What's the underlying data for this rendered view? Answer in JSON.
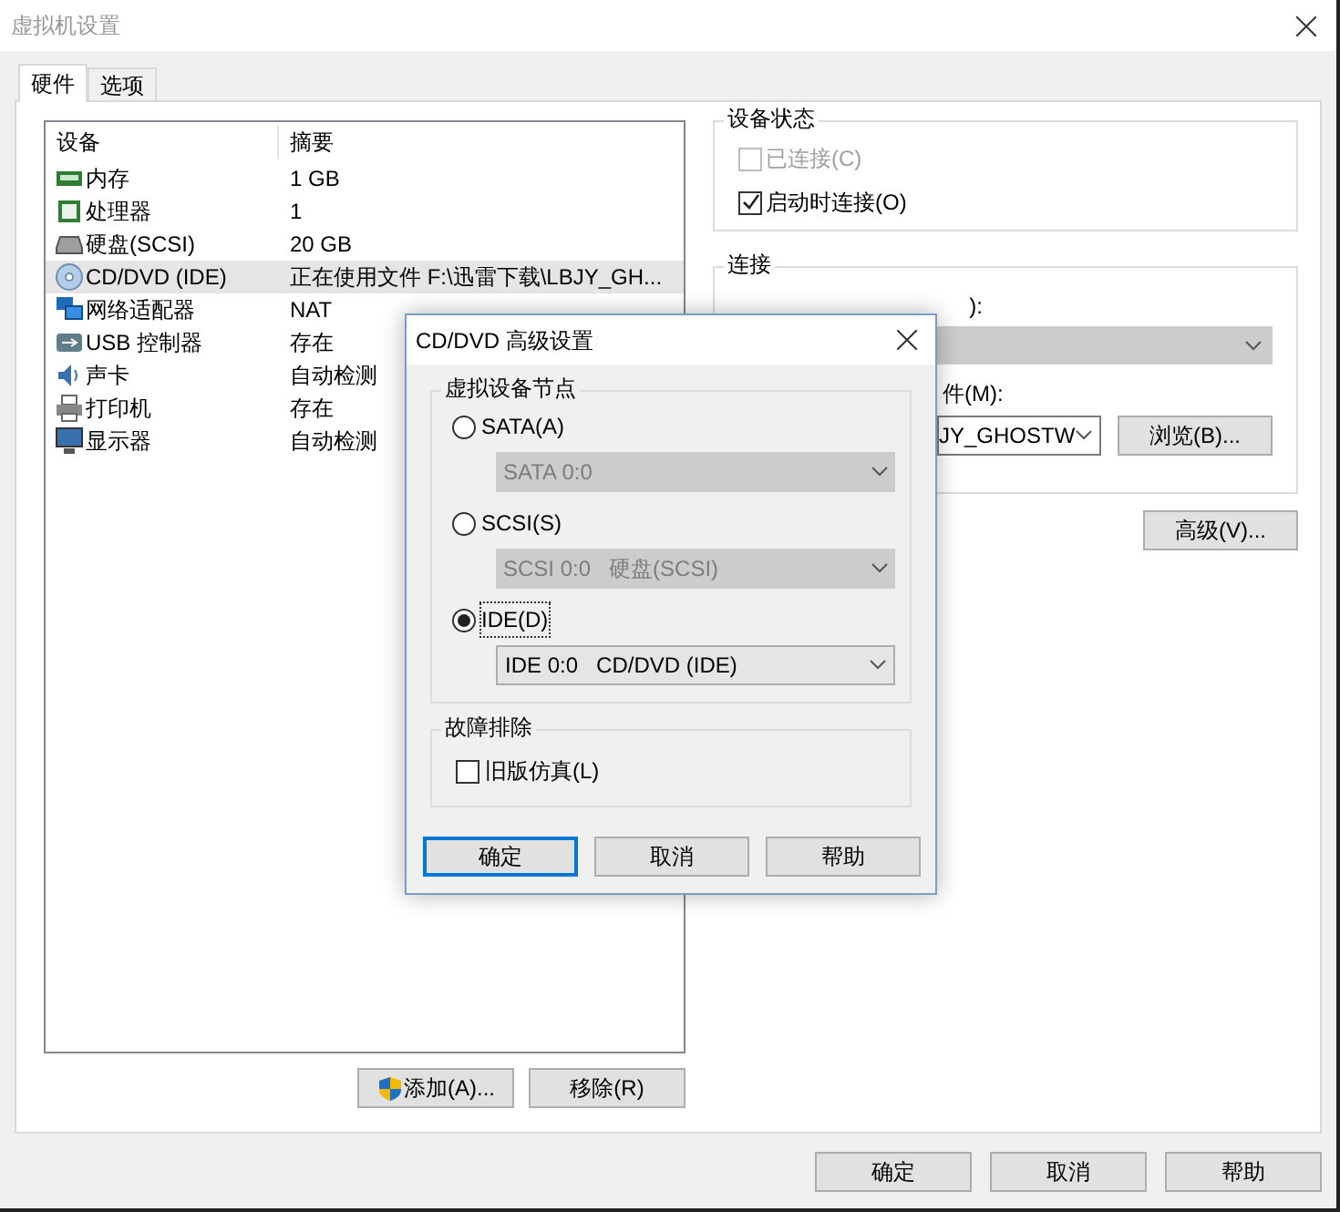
{
  "window": {
    "title": "虚拟机设置"
  },
  "tabs": [
    {
      "label": "硬件",
      "selected": true
    },
    {
      "label": "选项",
      "selected": false
    }
  ],
  "device_table": {
    "columns": [
      "设备",
      "摘要"
    ],
    "rows": [
      {
        "kind": "memory",
        "device": "内存",
        "summary": "1 GB",
        "selected": false
      },
      {
        "kind": "cpu",
        "device": "处理器",
        "summary": "1",
        "selected": false
      },
      {
        "kind": "disk",
        "device": "硬盘(SCSI)",
        "summary": "20 GB",
        "selected": false
      },
      {
        "kind": "cd",
        "device": "CD/DVD (IDE)",
        "summary": "正在使用文件 F:\\迅雷下载\\LBJY_GH...",
        "selected": true
      },
      {
        "kind": "network",
        "device": "网络适配器",
        "summary": "NAT",
        "selected": false
      },
      {
        "kind": "usb",
        "device": "USB 控制器",
        "summary": "存在",
        "selected": false
      },
      {
        "kind": "sound",
        "device": "声卡",
        "summary": "自动检测",
        "selected": false
      },
      {
        "kind": "printer",
        "device": "打印机",
        "summary": "存在",
        "selected": false
      },
      {
        "kind": "display",
        "device": "显示器",
        "summary": "自动检测",
        "selected": false
      }
    ]
  },
  "device_buttons": [
    "添加(A)...",
    "移除(R)"
  ],
  "device_status": {
    "title": "设备状态",
    "options": [
      {
        "label": "已连接(C)",
        "checked": false,
        "disabled": true
      },
      {
        "label": "启动时连接(O)",
        "checked": true,
        "disabled": false
      }
    ]
  },
  "connection": {
    "title": "连接",
    "physical_drive_label": "):",
    "iso_label": "件(M):",
    "iso_value": "JY_GHOSTW",
    "browse_button": "浏览(B)..."
  },
  "advanced_button": "高级(V)...",
  "footer_buttons": [
    "确定",
    "取消",
    "帮助"
  ],
  "dialog": {
    "title": "CD/DVD 高级设置",
    "node_group": {
      "title": "虚拟设备节点",
      "options": [
        {
          "label": "SATA(A)",
          "selected": false,
          "dropdown": "SATA 0:0",
          "disabled": true
        },
        {
          "label": "SCSI(S)",
          "selected": false,
          "dropdown": "SCSI 0:0   硬盘(SCSI)",
          "disabled": true
        },
        {
          "label": "IDE(D)",
          "selected": true,
          "dropdown": "IDE 0:0   CD/DVD (IDE)",
          "disabled": false
        }
      ]
    },
    "troubleshoot": {
      "title": "故障排除",
      "options": [
        {
          "label": "旧版仿真(L)",
          "checked": false
        }
      ]
    },
    "buttons": [
      {
        "label": "确定",
        "default": true
      },
      {
        "label": "取消",
        "default": false
      },
      {
        "label": "帮助",
        "default": false
      }
    ]
  }
}
